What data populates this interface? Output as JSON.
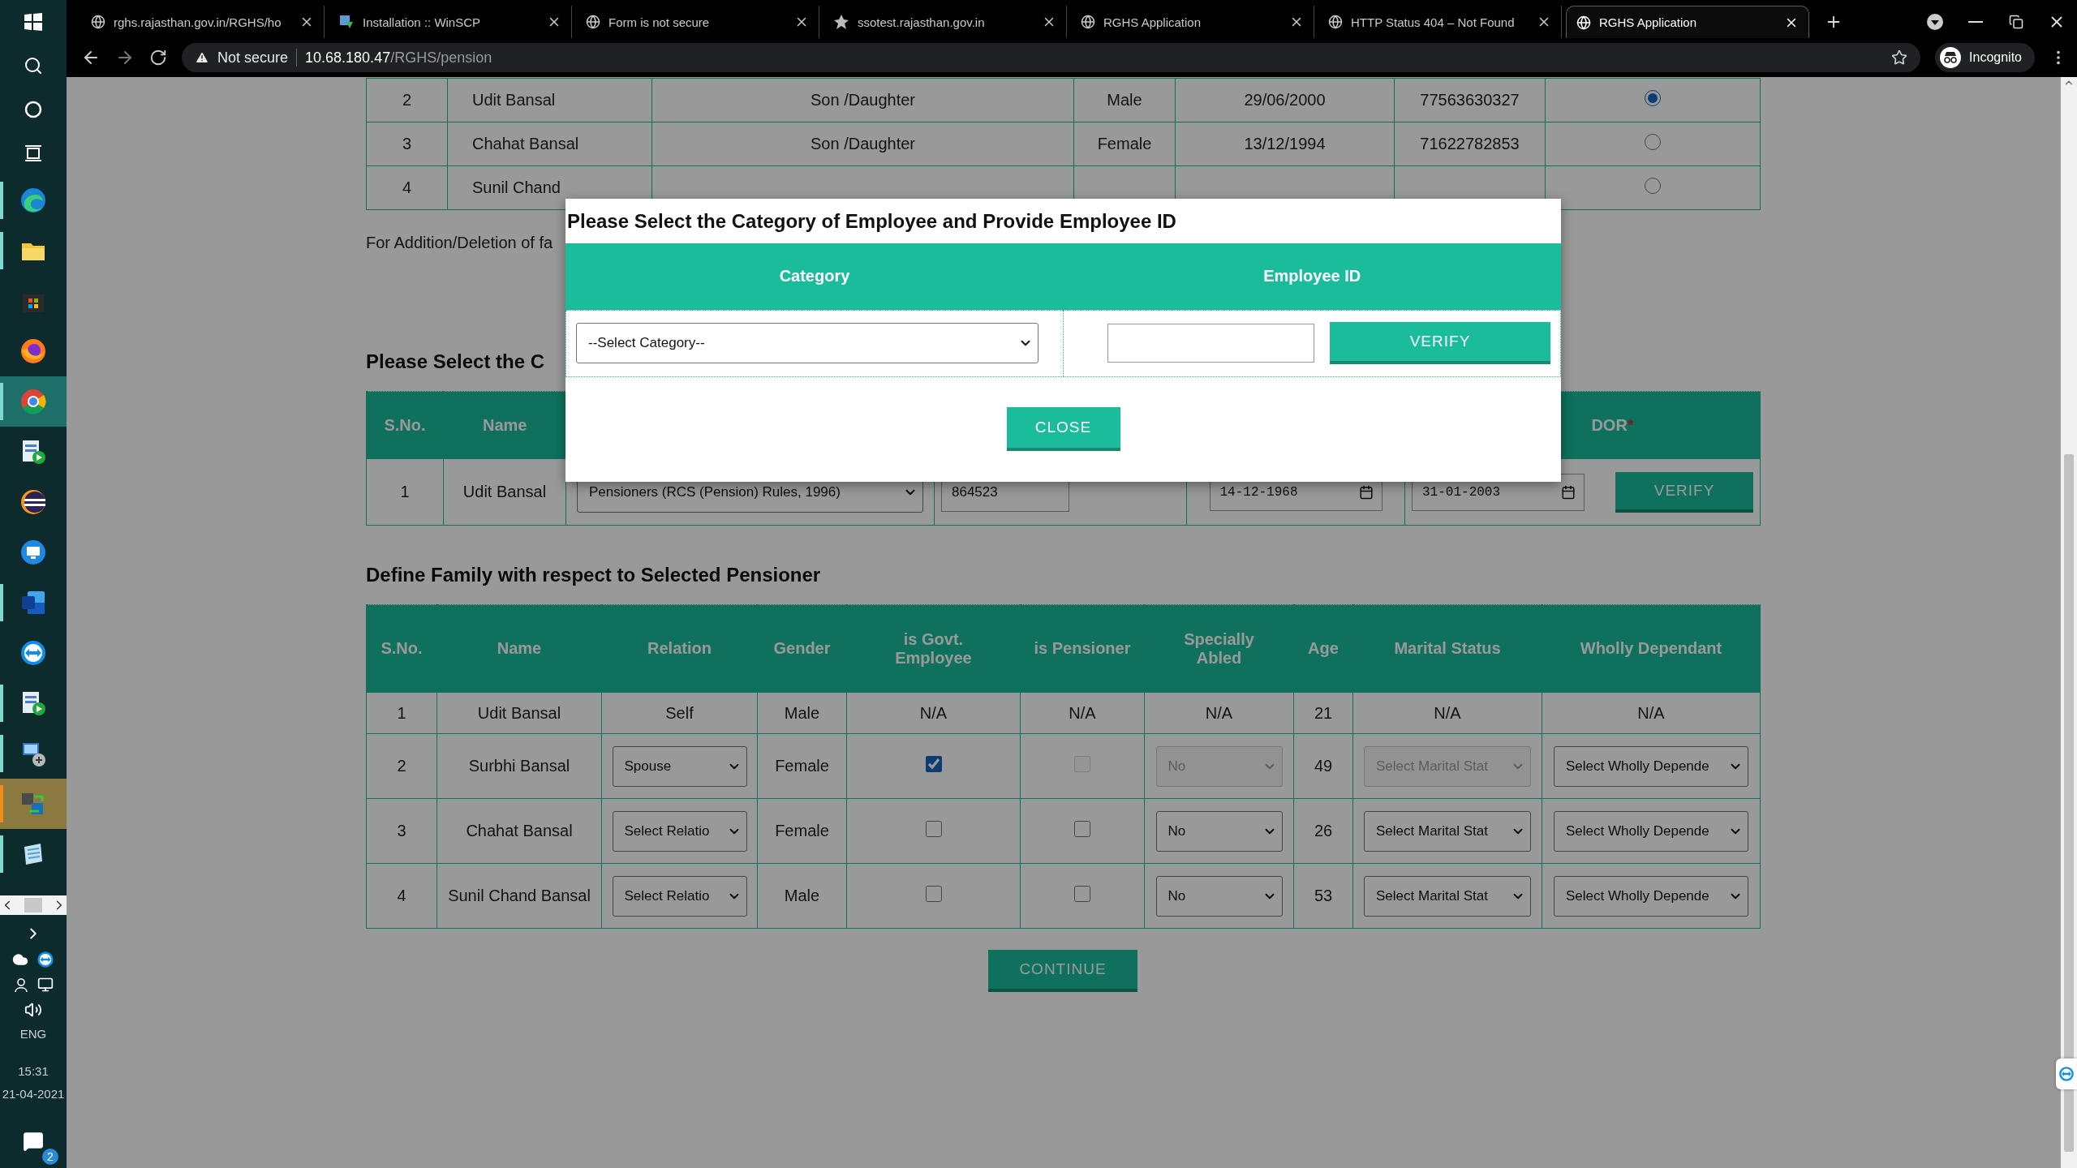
{
  "taskbar": {
    "apps": [
      {
        "kind": "edge",
        "running": true,
        "active": false,
        "attention": false
      },
      {
        "kind": "folder",
        "running": true,
        "active": false,
        "attention": false
      },
      {
        "kind": "store",
        "running": false,
        "active": false,
        "attention": false
      },
      {
        "kind": "firefox",
        "running": false,
        "active": false,
        "attention": false
      },
      {
        "kind": "chrome",
        "running": true,
        "active": true,
        "attention": false
      },
      {
        "kind": "app-play",
        "running": false,
        "active": false,
        "attention": false
      },
      {
        "kind": "eclipse",
        "running": false,
        "active": false,
        "attention": false
      },
      {
        "kind": "remote",
        "running": false,
        "active": false,
        "attention": false
      },
      {
        "kind": "word",
        "running": true,
        "active": false,
        "attention": false
      },
      {
        "kind": "teamviewer",
        "running": false,
        "active": false,
        "attention": false
      },
      {
        "kind": "app-play",
        "running": true,
        "active": false,
        "attention": false
      },
      {
        "kind": "network",
        "running": true,
        "active": false,
        "attention": false
      },
      {
        "kind": "transfer",
        "running": true,
        "active": false,
        "attention": true
      },
      {
        "kind": "notepad",
        "running": true,
        "active": false,
        "attention": false
      }
    ],
    "language": "ENG",
    "time": "15:31",
    "date": "21-04-2021",
    "notification_count": "2"
  },
  "browser": {
    "tabs": [
      {
        "title": "rghs.rajasthan.gov.in/RGHS/ho",
        "selected": false
      },
      {
        "title": "Installation :: WinSCP",
        "selected": false
      },
      {
        "title": "Form is not secure",
        "selected": false
      },
      {
        "title": "ssotest.rajasthan.gov.in",
        "selected": false
      },
      {
        "title": "RGHS Application",
        "selected": false
      },
      {
        "title": "HTTP Status 404 – Not Found",
        "selected": false
      },
      {
        "title": "RGHS Application",
        "selected": true
      }
    ],
    "security": "Not secure",
    "host": "10.68.180.47",
    "path": "/RGHS/pension",
    "profile": "Incognito"
  },
  "family_list": {
    "rows": [
      {
        "sno": "2",
        "name": "Udit Bansal",
        "relation": "Son /Daughter",
        "gender": "Male",
        "dob": "29/06/2000",
        "id_number": "77563630327",
        "selected": true
      },
      {
        "sno": "3",
        "name": "Chahat Bansal",
        "relation": "Son /Daughter",
        "gender": "Female",
        "dob": "13/12/1994",
        "id_number": "71622782853",
        "selected": false
      },
      {
        "sno": "4",
        "name": "Sunil Chand",
        "selected": false
      }
    ]
  },
  "note": "For Addition/Deletion of fa",
  "pensioner": {
    "heading": "Please Select the C",
    "columns": [
      "S.No.",
      "Name"
    ],
    "last_column": "DOR",
    "required_mark": "*",
    "row": {
      "sno": "1",
      "name": "Udit Bansal",
      "category": "Pensioners (RCS (Pension) Rules, 1996)",
      "employee_id": "864523",
      "dob": "14-12-1968",
      "dor": "31-01-2003",
      "verify": "VERIFY"
    }
  },
  "family": {
    "heading": "Define Family with respect to Selected Pensioner",
    "columns": [
      "S.No.",
      "Name",
      "Relation",
      "Gender",
      "is Govt. Employee",
      "is Pensioner",
      "Specially Abled",
      "Age",
      "Marital Status",
      "Wholly Dependant"
    ],
    "rows": [
      {
        "kind": "static",
        "sno": "1",
        "name": "Udit Bansal",
        "relation": "Self",
        "gender": "Male",
        "govt_employee": "N/A",
        "pensioner": "N/A",
        "specially_abled": "N/A",
        "age": "21",
        "marital_status": "N/A",
        "wholly_dependant": "N/A"
      },
      {
        "kind": "editable",
        "sno": "2",
        "name": "Surbhi Bansal",
        "relation": {
          "value": "Spouse",
          "disabled": false
        },
        "gender": "Female",
        "govt_employee": {
          "checked": true,
          "disabled": false
        },
        "pensioner": {
          "checked": false,
          "disabled": true
        },
        "specially_abled": {
          "value": "No",
          "disabled": true
        },
        "age": "49",
        "marital_status": {
          "value": "Select Marital Stat",
          "disabled": true
        },
        "wholly_dependant": {
          "value": "Select Wholly Depende",
          "disabled": false
        }
      },
      {
        "kind": "editable",
        "sno": "3",
        "name": "Chahat Bansal",
        "relation": {
          "value": "Select Relatio",
          "disabled": false
        },
        "gender": "Female",
        "govt_employee": {
          "checked": false,
          "disabled": false
        },
        "pensioner": {
          "checked": false,
          "disabled": false
        },
        "specially_abled": {
          "value": "No",
          "disabled": false
        },
        "age": "26",
        "marital_status": {
          "value": "Select Marital Stat",
          "disabled": false
        },
        "wholly_dependant": {
          "value": "Select Wholly Depende",
          "disabled": false
        }
      },
      {
        "kind": "editable",
        "sno": "4",
        "name": "Sunil Chand Bansal",
        "relation": {
          "value": "Select Relatio",
          "disabled": false
        },
        "gender": "Male",
        "govt_employee": {
          "checked": false,
          "disabled": false
        },
        "pensioner": {
          "checked": false,
          "disabled": false
        },
        "specially_abled": {
          "value": "No",
          "disabled": false
        },
        "age": "53",
        "marital_status": {
          "value": "Select Marital Stat",
          "disabled": false
        },
        "wholly_dependant": {
          "value": "Select Wholly Depende",
          "disabled": false
        }
      }
    ],
    "continue": "CONTINUE"
  },
  "modal": {
    "title": "Please Select the Category of Employee and Provide Employee ID",
    "columns": [
      "Category",
      "Employee ID"
    ],
    "category": "--Select Category--",
    "verify": "VERIFY",
    "close": "CLOSE"
  }
}
